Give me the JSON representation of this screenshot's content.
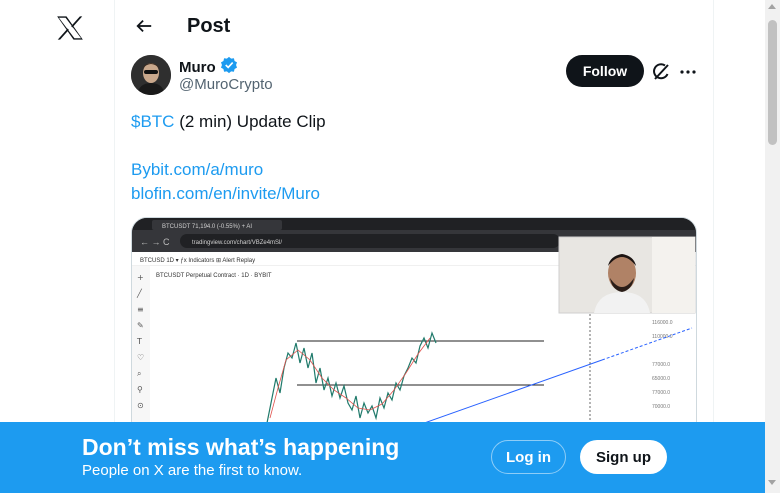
{
  "nav": {
    "logo_icon": "x-logo-icon",
    "back_icon": "back-arrow-icon"
  },
  "header": {
    "title": "Post"
  },
  "post": {
    "author": {
      "name": "Muro",
      "handle": "@MuroCrypto",
      "verified_icon": "verified-badge-icon"
    },
    "follow_label": "Follow",
    "grok_icon": "grok-icon",
    "more_icon": "more-icon",
    "text": {
      "cashtag": "$BTC",
      "rest": " (2 min) Update Clip",
      "link1": "Bybit.com/a/muro",
      "link2": "blofin.com/en/invite/Muro"
    },
    "media": {
      "browser_tab_title": "BTCUSDT 71,194.0 (-0.55%) + AI",
      "url": "tradingview.com/chart/VBZe4mSl/",
      "symbol_line": "BTCUSDT Perpetual Contract · 1D · BYBIT"
    }
  },
  "banner": {
    "title": "Don’t miss what’s happening",
    "subtitle": "People on X are the first to know.",
    "login_label": "Log in",
    "signup_label": "Sign up"
  },
  "colors": {
    "accent": "#1d9bf0",
    "text": "#0f1419",
    "secondary": "#536471"
  }
}
